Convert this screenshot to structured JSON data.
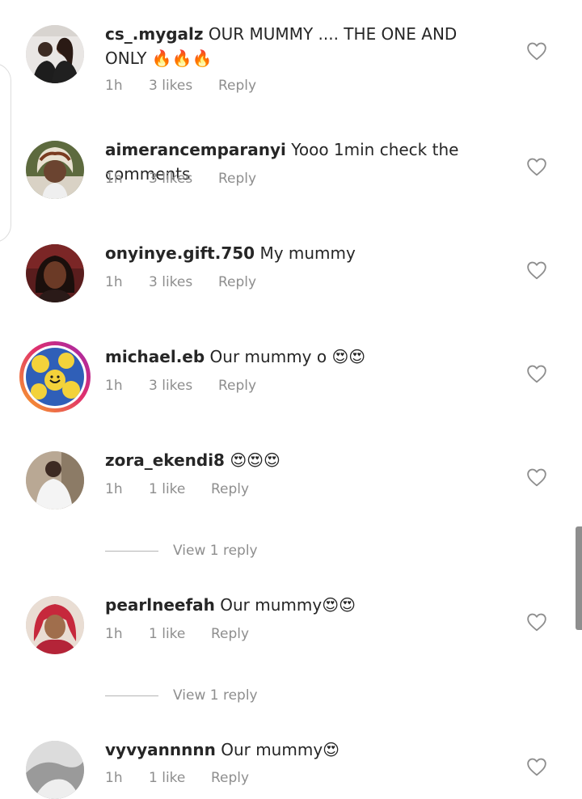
{
  "comments": [
    {
      "username": "cs_.mygalz",
      "text": "OUR MUMMY .... THE ONE AND ONLY 🔥🔥🔥",
      "time": "1h",
      "likes": "3 likes",
      "reply": "Reply"
    },
    {
      "username": "aimerancemparanyi",
      "text": "Yooo 1min check the comments",
      "time": "1h",
      "likes": "3 likes",
      "reply": "Reply"
    },
    {
      "username": "onyinye.gift.750",
      "text": "My mummy",
      "time": "1h",
      "likes": "3 likes",
      "reply": "Reply"
    },
    {
      "username": "michael.eb",
      "text": "Our mummy o 😍😍",
      "time": "1h",
      "likes": "3 likes",
      "reply": "Reply"
    },
    {
      "username": "zora_ekendi8",
      "text": "😍😍😍",
      "time": "1h",
      "likes": "1 like",
      "reply": "Reply"
    },
    {
      "username": "pearlneefah",
      "text": "Our mummy😍😍",
      "time": "1h",
      "likes": "1 like",
      "reply": "Reply"
    },
    {
      "username": "vyvyannnnn",
      "text": "Our mummy😍",
      "time": "1h",
      "likes": "1 like",
      "reply": "Reply"
    }
  ],
  "view_replies": [
    "View 1 reply",
    "View 1 reply"
  ],
  "colors": {
    "text": "#262626",
    "muted": "#8e8e8e",
    "story_ring": [
      "#f9a825",
      "#e1306c",
      "#9c27b0"
    ]
  },
  "icons": {
    "like": "heart-outline-icon"
  }
}
